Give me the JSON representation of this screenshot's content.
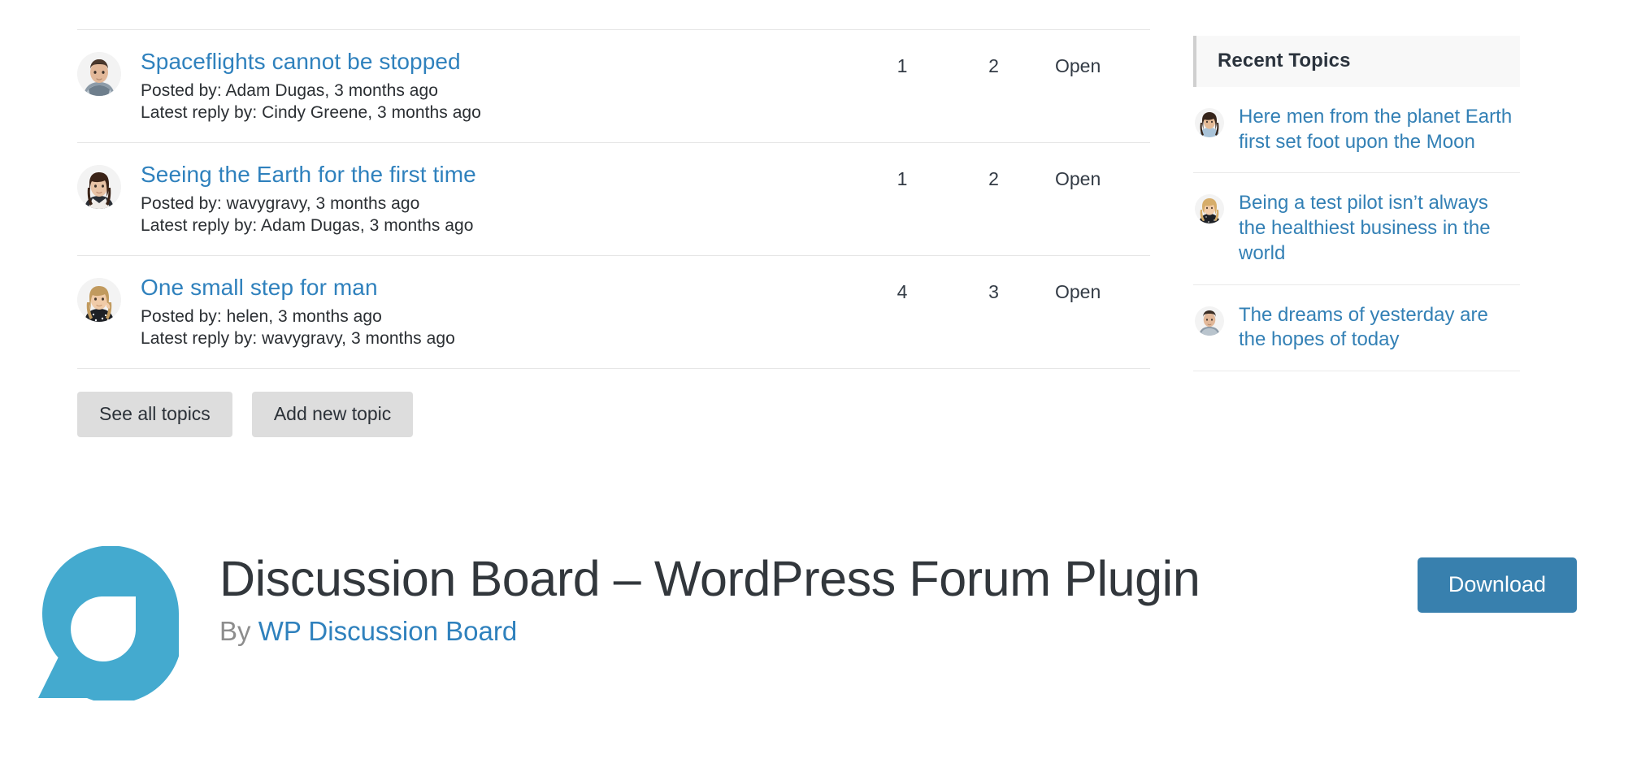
{
  "forum": {
    "topics": [
      {
        "title": "Spaceflights cannot be stopped",
        "posted_by": "Posted by: Adam Dugas, 3 months ago",
        "latest_reply": "Latest reply by: Cindy Greene, 3 months ago",
        "voices": "1",
        "replies": "2",
        "status": "Open",
        "avatar": "man-dark-hair-plaid-shirt"
      },
      {
        "title": "Seeing the Earth for the first time",
        "posted_by": "Posted by: wavygravy, 3 months ago",
        "latest_reply": "Latest reply by: Adam Dugas, 3 months ago",
        "voices": "1",
        "replies": "2",
        "status": "Open",
        "avatar": "woman-long-dark-hair"
      },
      {
        "title": "One small step for man",
        "posted_by": "Posted by: helen, 3 months ago",
        "latest_reply": "Latest reply by: wavygravy, 3 months ago",
        "voices": "4",
        "replies": "3",
        "status": "Open",
        "avatar": "woman-blonde-black-top"
      }
    ],
    "buttons": {
      "see_all": "See all topics",
      "add_new": "Add new topic"
    }
  },
  "sidebar": {
    "widget_title": "Recent Topics",
    "items": [
      {
        "title": "Here men from the planet Earth first set foot upon the Moon",
        "avatar": "woman-curly-dark-hair"
      },
      {
        "title": "Being a test pilot isn’t always the healthiest business in the world",
        "avatar": "woman-blonde-polka-dot"
      },
      {
        "title": "The dreams of yesterday are the hopes of today",
        "avatar": "man-dark-hair-plaid-shirt"
      }
    ]
  },
  "plugin": {
    "title": "Discussion Board – WordPress Forum Plugin",
    "by_prefix": "By ",
    "author": "WP Discussion Board",
    "download_label": "Download",
    "logo_name": "discussion-board-teardrop-logo"
  },
  "colors": {
    "link_blue": "#2f81bd",
    "sidebar_link_blue": "#3380b5",
    "logo_teal": "#44aacf",
    "download_blue": "#3880ae",
    "button_grey": "#dddddd",
    "text_dark": "#2b2f33",
    "divider": "#e6e6e6"
  }
}
